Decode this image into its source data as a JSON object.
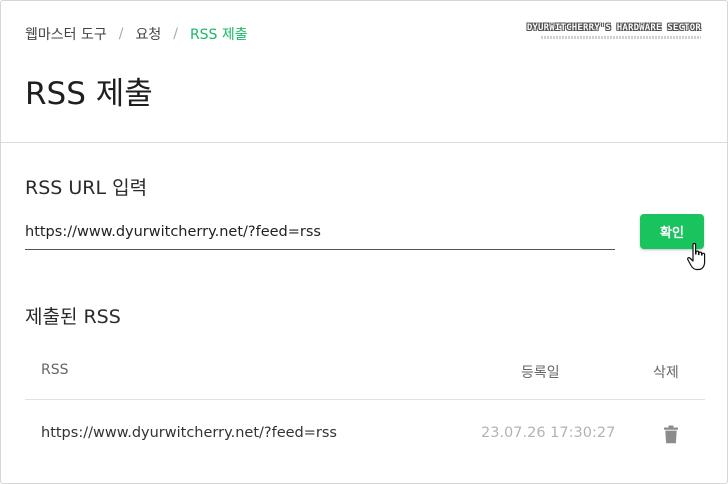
{
  "breadcrumb": {
    "items": [
      "웹마스터 도구",
      "요청",
      "RSS 제출"
    ],
    "separator": "/"
  },
  "watermark": {
    "text": "DYURWITCHERRY'S HARDWARE SECTOR"
  },
  "page": {
    "title": "RSS 제출"
  },
  "url_input": {
    "label": "RSS URL 입력",
    "value": "https://www.dyurwitcherry.net/?feed=rss",
    "button_label": "확인"
  },
  "submitted": {
    "label": "제출된 RSS",
    "columns": {
      "rss": "RSS",
      "registered": "등록일",
      "delete": "삭제"
    },
    "rows": [
      {
        "rss": "https://www.dyurwitcherry.net/?feed=rss",
        "registered": "23.07.26 17:30:27",
        "delete_icon": "trash-icon"
      }
    ]
  },
  "colors": {
    "accent": "#19c35e",
    "breadcrumb_current": "#19b863",
    "date_text": "#b3b3b3"
  }
}
